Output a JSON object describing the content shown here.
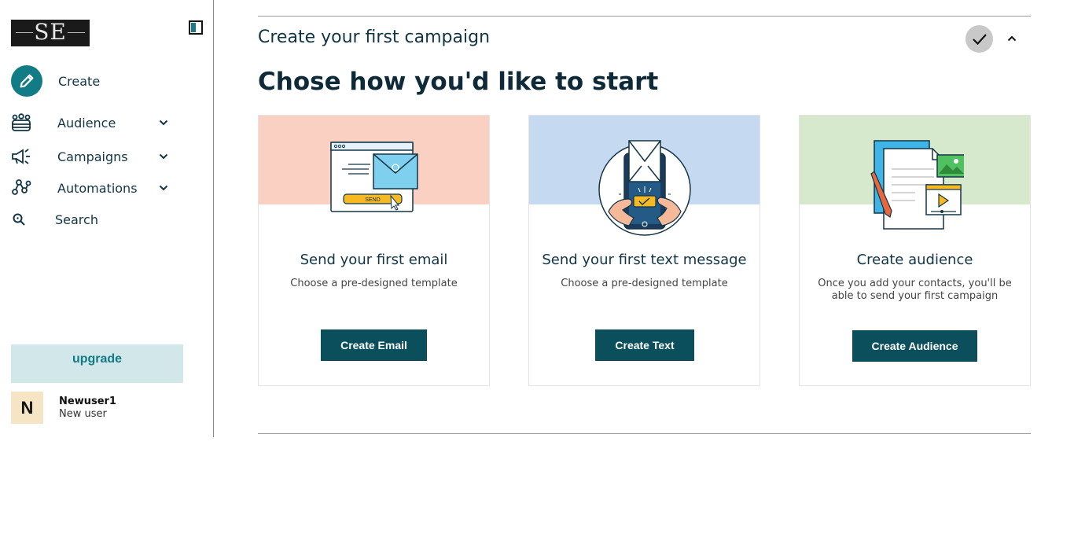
{
  "sidebar": {
    "logo": {
      "text": "SE"
    },
    "nav": {
      "create": "Create",
      "audience": "Audience",
      "campaigns": "Campaigns",
      "automations": "Automations",
      "search": "Search"
    },
    "upgrade_label": "upgrade",
    "user": {
      "initial": "N",
      "name": "Newuser1",
      "role": "New user"
    }
  },
  "main": {
    "section_title": "Create your first campaign",
    "heading": "Chose how you'd like to start",
    "cards": [
      {
        "title": "Send your first email",
        "description": "Choose a pre-designed template",
        "button": "Create Email",
        "band_color": "#f9d0c1",
        "illus_send_label": "SEND"
      },
      {
        "title": "Send your first text message",
        "description": "Choose a pre-designed template",
        "button": "Create Text",
        "band_color": "#c5daf1"
      },
      {
        "title": "Create audience",
        "description": "Once you add your contacts, you'll be able to send your first campaign",
        "button": "Create Audience",
        "band_color": "#d6e9cc"
      }
    ]
  },
  "colors": {
    "brand_teal": "#117c86",
    "button_dark": "#0b4f5c",
    "upgrade_bg": "#d2e7ea",
    "avatar_bg": "#f6e5c4"
  }
}
